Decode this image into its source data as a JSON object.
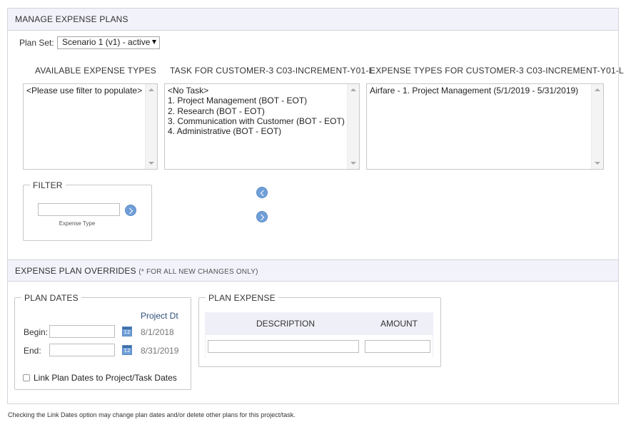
{
  "section_manage": {
    "title": "MANAGE EXPENSE PLANS"
  },
  "plan_set": {
    "label": "Plan Set:",
    "selected": "Scenario 1 (v1) - active"
  },
  "columns": {
    "available": {
      "header": "AVAILABLE EXPENSE TYPES",
      "items": [
        "<Please use filter to populate>"
      ]
    },
    "tasks": {
      "header": "TASK FOR CUSTOMER-3 C03-INCREMENT-Y01-L",
      "items": [
        "<No Task>",
        "1. Project Management (BOT - EOT)",
        "2. Research (BOT - EOT)",
        "3. Communication with Customer (BOT - EOT)",
        "4. Administrative (BOT - EOT)"
      ]
    },
    "expense_types": {
      "header": "EXPENSE TYPES FOR CUSTOMER-3 C03-INCREMENT-Y01-L",
      "items": [
        "Airfare - 1. Project Management (5/1/2019 - 5/31/2019)"
      ]
    }
  },
  "filter": {
    "legend": "FILTER",
    "input_value": "",
    "caption": "Expense Type"
  },
  "section_overrides": {
    "title": "EXPENSE PLAN OVERRIDES",
    "note": "(* FOR ALL NEW CHANGES ONLY)"
  },
  "plan_dates": {
    "legend": "PLAN DATES",
    "project_dt_header": "Project Dt",
    "begin_label": "Begin:",
    "begin_value": "",
    "begin_project_dt": "8/1/2018",
    "end_label": "End:",
    "end_value": "",
    "end_project_dt": "8/31/2019",
    "calendar_number": "12",
    "link_label": "Link Plan Dates to Project/Task Dates",
    "link_checked": false
  },
  "plan_expense": {
    "legend": "PLAN EXPENSE",
    "col_description": "DESCRIPTION",
    "col_amount": "AMOUNT",
    "description_value": "",
    "amount_value": ""
  },
  "footer_note": "Checking the Link Dates option may change plan dates and/or delete other plans for this project/task.",
  "colors": {
    "header_bg": "#f2f2fb",
    "accent_blue": "#6f9fd8",
    "border": "#d4d4dc"
  }
}
